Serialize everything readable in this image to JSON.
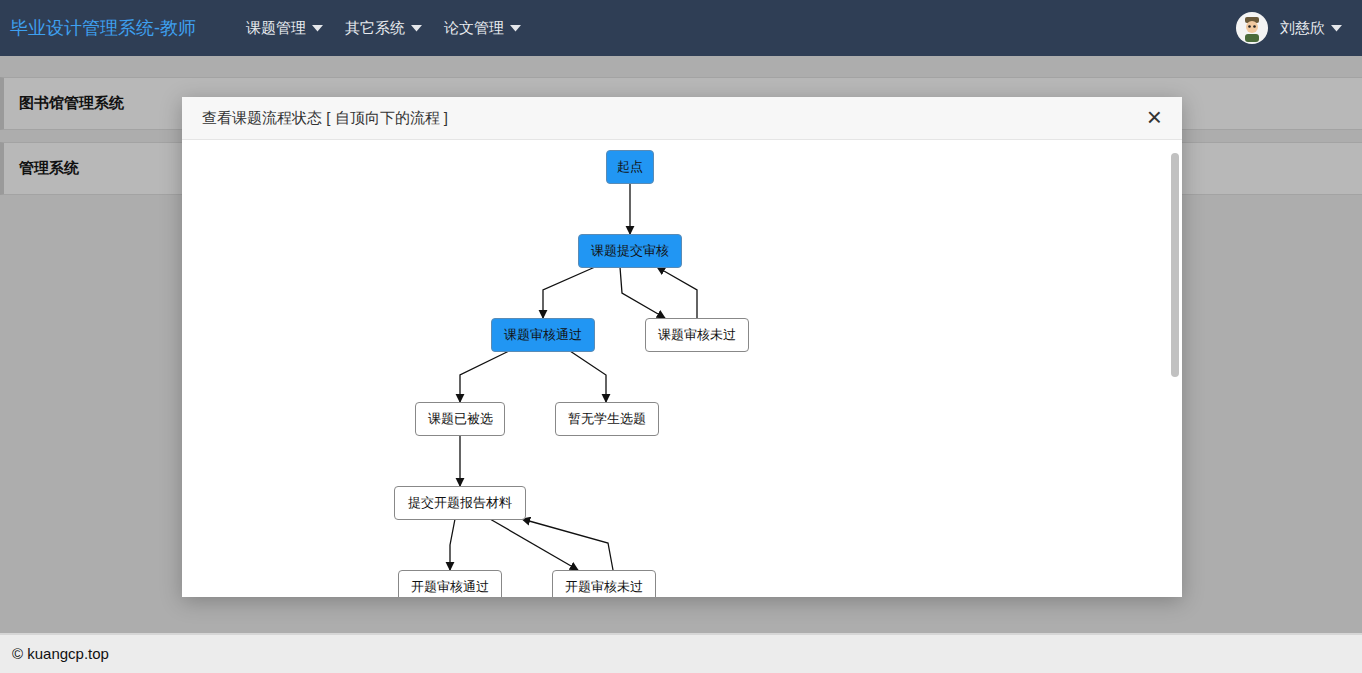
{
  "navbar": {
    "brand": "毕业设计管理系统-教师",
    "menus": [
      {
        "label": "课题管理"
      },
      {
        "label": "其它系统"
      },
      {
        "label": "论文管理"
      }
    ],
    "user": {
      "name": "刘慈欣"
    }
  },
  "page": {
    "rows": [
      "图书馆管理系统",
      "管理系统"
    ]
  },
  "modal": {
    "title": "查看课题流程状态 [ 自顶向下的流程 ]",
    "close": "×",
    "flow": {
      "nodes": [
        {
          "label": "起点",
          "active": true
        },
        {
          "label": "课题提交审核",
          "active": true
        },
        {
          "label": "课题审核通过",
          "active": true
        },
        {
          "label": "课题审核未过",
          "active": false
        },
        {
          "label": "课题已被选",
          "active": false
        },
        {
          "label": "暂无学生选题",
          "active": false
        },
        {
          "label": "提交开题报告材料",
          "active": false
        },
        {
          "label": "开题审核通过",
          "active": false
        },
        {
          "label": "开题审核未过",
          "active": false
        }
      ],
      "edges": [
        [
          0,
          1
        ],
        [
          1,
          2
        ],
        [
          1,
          3
        ],
        [
          3,
          1
        ],
        [
          2,
          4
        ],
        [
          2,
          5
        ],
        [
          4,
          6
        ],
        [
          6,
          7
        ],
        [
          6,
          8
        ],
        [
          8,
          6
        ]
      ]
    }
  },
  "footer": {
    "text": "© kuangcp.top"
  }
}
